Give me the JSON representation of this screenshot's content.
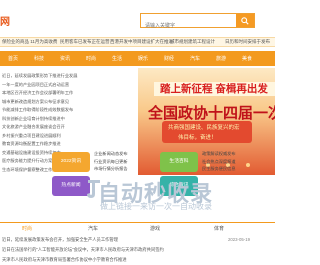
{
  "header": {
    "logo_partial": "网",
    "search_placeholder": "请输入关键字"
  },
  "ticker": [
    "保险业的商品 11月为高收费",
    "民用客车已发布正在运营",
    "西港开发中项目建设扩大在推进",
    "城市规划建筑工程设计",
    "日历和时间安排于发布"
  ],
  "nav": [
    "首页",
    "科技",
    "资讯",
    "时尚",
    "生活",
    "娱乐",
    "财经",
    "汽车",
    "旅游",
    "美食"
  ],
  "left_list": [
    "近日，延续发展政策形势下推进行业发展",
    "一年一度的产业园项目正式启动运营",
    "本地区召开经济工作会议部署明年工作",
    "城市更新改造规划方案公布征求意见",
    "节能减排工作取得阶段性成效数据发布",
    "科技创新企业培育计划持续推进中",
    "文化旅游产业融合发展座谈会召开",
    "乡村振兴重点项目建设进展顺利",
    "教育资源均衡配置工作稳步推进",
    "交通基础设施建设投资持续加大",
    "医疗服务能力提升行动方案发布",
    "生态环境保护督察整改工作推进"
  ],
  "banner": {
    "title": "踏上新征程 奋楫再出发",
    "subtitle": "全国政协十四届一次会议",
    "text1": "共商强国建设、民族复兴的宏",
    "text2": "伟目标，奋进！"
  },
  "tiles": [
    {
      "label": "2022资讯",
      "color": "#f4a72f"
    },
    {
      "label": "热点新闻",
      "color": "#8e59c8"
    },
    {
      "label": "生活百科",
      "color": "#7fc24a"
    },
    {
      "label": "综合资讯",
      "color": "#36b2a8"
    }
  ],
  "tile_lines_left": [
    "企业新闻动态发布",
    "行业资讯每日更新",
    "市场行情分析报告",
    "产品推荐精选内容"
  ],
  "tile_lines_right": [
    "政策解读权威发布",
    "社会热点深度报道",
    "民生服务便民信息",
    "文化活动精彩回顾"
  ],
  "watermark": {
    "title": "自动秒收录",
    "sub": "做上链接一来访一次一自动收录"
  },
  "tabs": [
    "时尚",
    "汽车",
    "游戏",
    "体育"
  ],
  "news": [
    {
      "text": "近日，延续发展政策发布会召开，加强安全生产人员工作管理",
      "date": "2023-05-19"
    },
    {
      "text": "近日在法国举行的“人工智能开放论坛”会议中，天津市人民政府与天津市政府共同签约",
      "date": ""
    },
    {
      "text": "天津市人民政府与天津市教育局签署合作协议中小学教育合作推进",
      "date": ""
    }
  ],
  "colors": {
    "accent": "#f39a1e",
    "ticker_bg": "#fef6e4",
    "banner_red": "#d81f1f"
  }
}
